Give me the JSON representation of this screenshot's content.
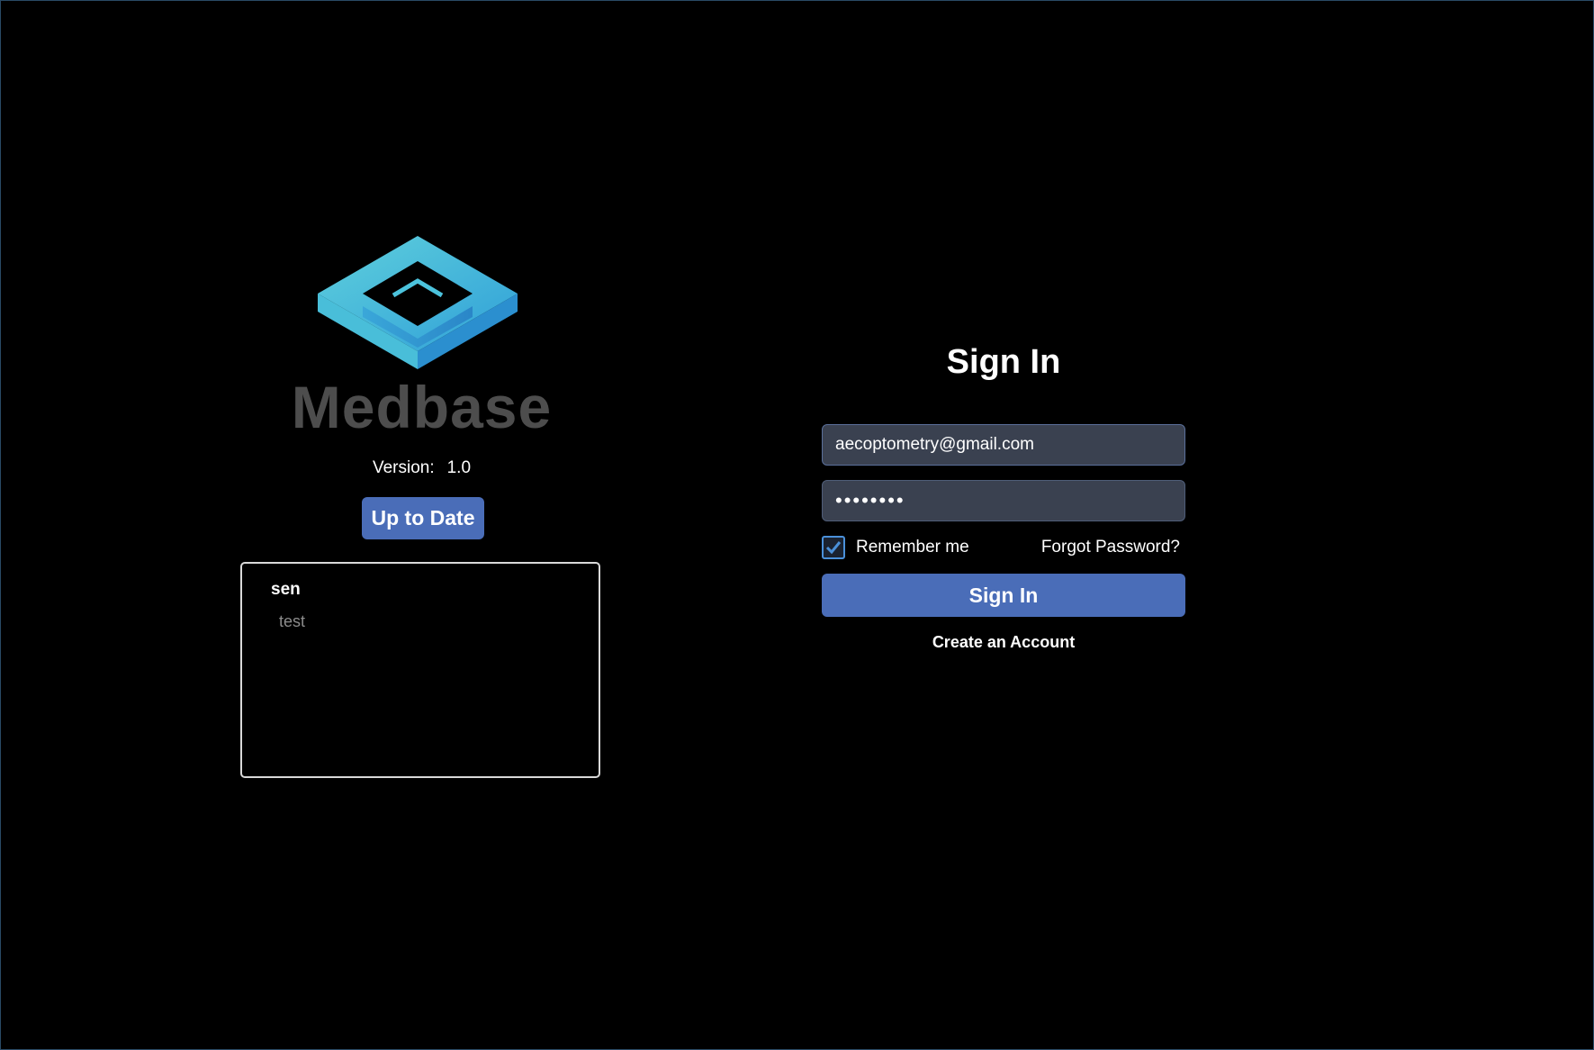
{
  "app": {
    "brand_name": "Medbase",
    "version_label": "Version:",
    "version_value": "1.0",
    "update_button_label": "Up to Date",
    "accent_color": "#4a6db8",
    "logo_icon": "medbase-cube-logo-icon"
  },
  "release_notes": {
    "title": "sen",
    "body": "test"
  },
  "signin": {
    "title": "Sign In",
    "email_value": "aecoptometry@gmail.com",
    "password_value": "••••••••",
    "remember_label": "Remember me",
    "remember_checked": true,
    "forgot_label": "Forgot Password?",
    "submit_label": "Sign In",
    "create_account_label": "Create an Account"
  }
}
